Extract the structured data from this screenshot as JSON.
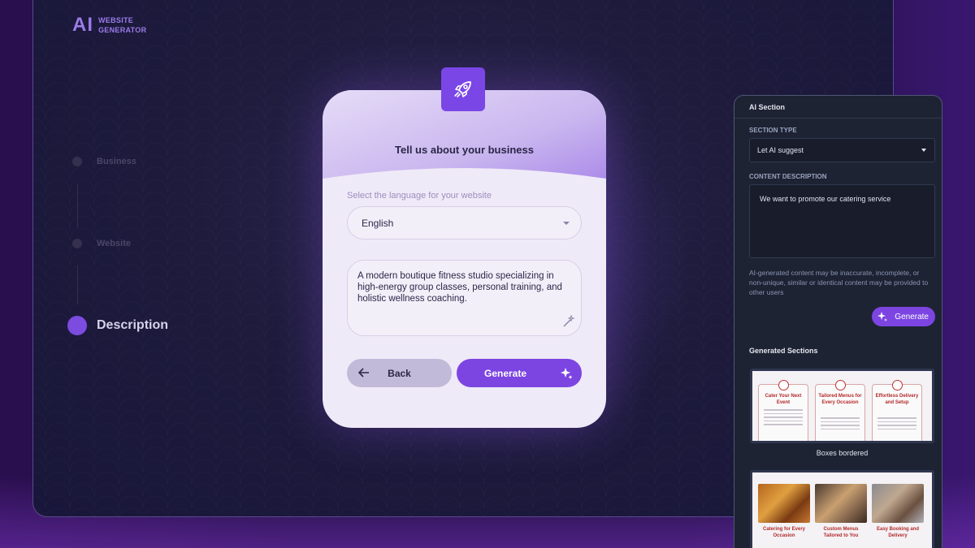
{
  "logo": {
    "mark": "AI",
    "line1": "WEBSITE",
    "line2": "GENERATOR"
  },
  "steps": [
    {
      "label": "Business",
      "state": "inactive"
    },
    {
      "label": "Website",
      "state": "inactive"
    },
    {
      "label": "Description",
      "state": "active"
    }
  ],
  "card": {
    "icon": "rocket-icon",
    "title": "Tell us about your business",
    "language_label": "Select the language for your website",
    "language_value": "English",
    "description": "A modern boutique fitness studio specializing in high-energy group classes, personal training, and holistic wellness coaching.",
    "back_label": "Back",
    "generate_label": "Generate"
  },
  "panel": {
    "title": "AI Section",
    "section_type_label": "SECTION TYPE",
    "section_type_value": "Let AI suggest",
    "content_label": "CONTENT DESCRIPTION",
    "content_value": "We want to promote our catering service",
    "disclaimer": "AI-generated content may be inaccurate, incomplete, or non-unique, similar or identical content may be provided to other users",
    "generate_label": "Generate",
    "generated_title": "Generated Sections",
    "sections": [
      {
        "caption": "Boxes bordered",
        "items": [
          "Cater Your Next Event",
          "Tailored Menus for Every Occasion",
          "Effortless Delivery and Setup"
        ]
      },
      {
        "caption": "",
        "items": [
          "Catering for Every Occasion",
          "Custom Menus Tailored to You",
          "Easy Booking and Delivery"
        ]
      }
    ]
  },
  "colors": {
    "accent": "#7c45e2",
    "card_bg": "#efeaf7",
    "panel_bg": "#1e2333"
  }
}
